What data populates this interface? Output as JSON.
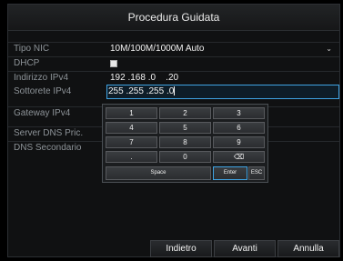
{
  "window": {
    "title": "Procedura Guidata"
  },
  "form": {
    "nic_type": {
      "label": "Tipo NIC",
      "value": "10M/100M/1000M Auto"
    },
    "dhcp": {
      "label": "DHCP"
    },
    "ipv4": {
      "label": "Indirizzo IPv4",
      "octets": [
        "192",
        "168",
        "0",
        "20"
      ]
    },
    "subnet": {
      "label": "Sottorete IPv4",
      "octets": [
        "255",
        "255",
        "255",
        "0"
      ]
    },
    "gateway": {
      "label": "Gateway IPv4"
    },
    "dns_primary": {
      "label": "Server DNS Pric."
    },
    "dns_secondary": {
      "label": "DNS Secondario"
    }
  },
  "keypad": {
    "keys": [
      "1",
      "2",
      "3",
      "4",
      "5",
      "6",
      "7",
      "8",
      "9",
      ".",
      "0",
      "⌫"
    ],
    "space": "Space",
    "enter": "Enter",
    "esc": "ESC"
  },
  "footer": {
    "back_label": "Indietro",
    "next_label": "Avanti",
    "cancel_label": "Annulla"
  },
  "colors": {
    "accent": "#3fa3e3",
    "background": "#101112"
  }
}
